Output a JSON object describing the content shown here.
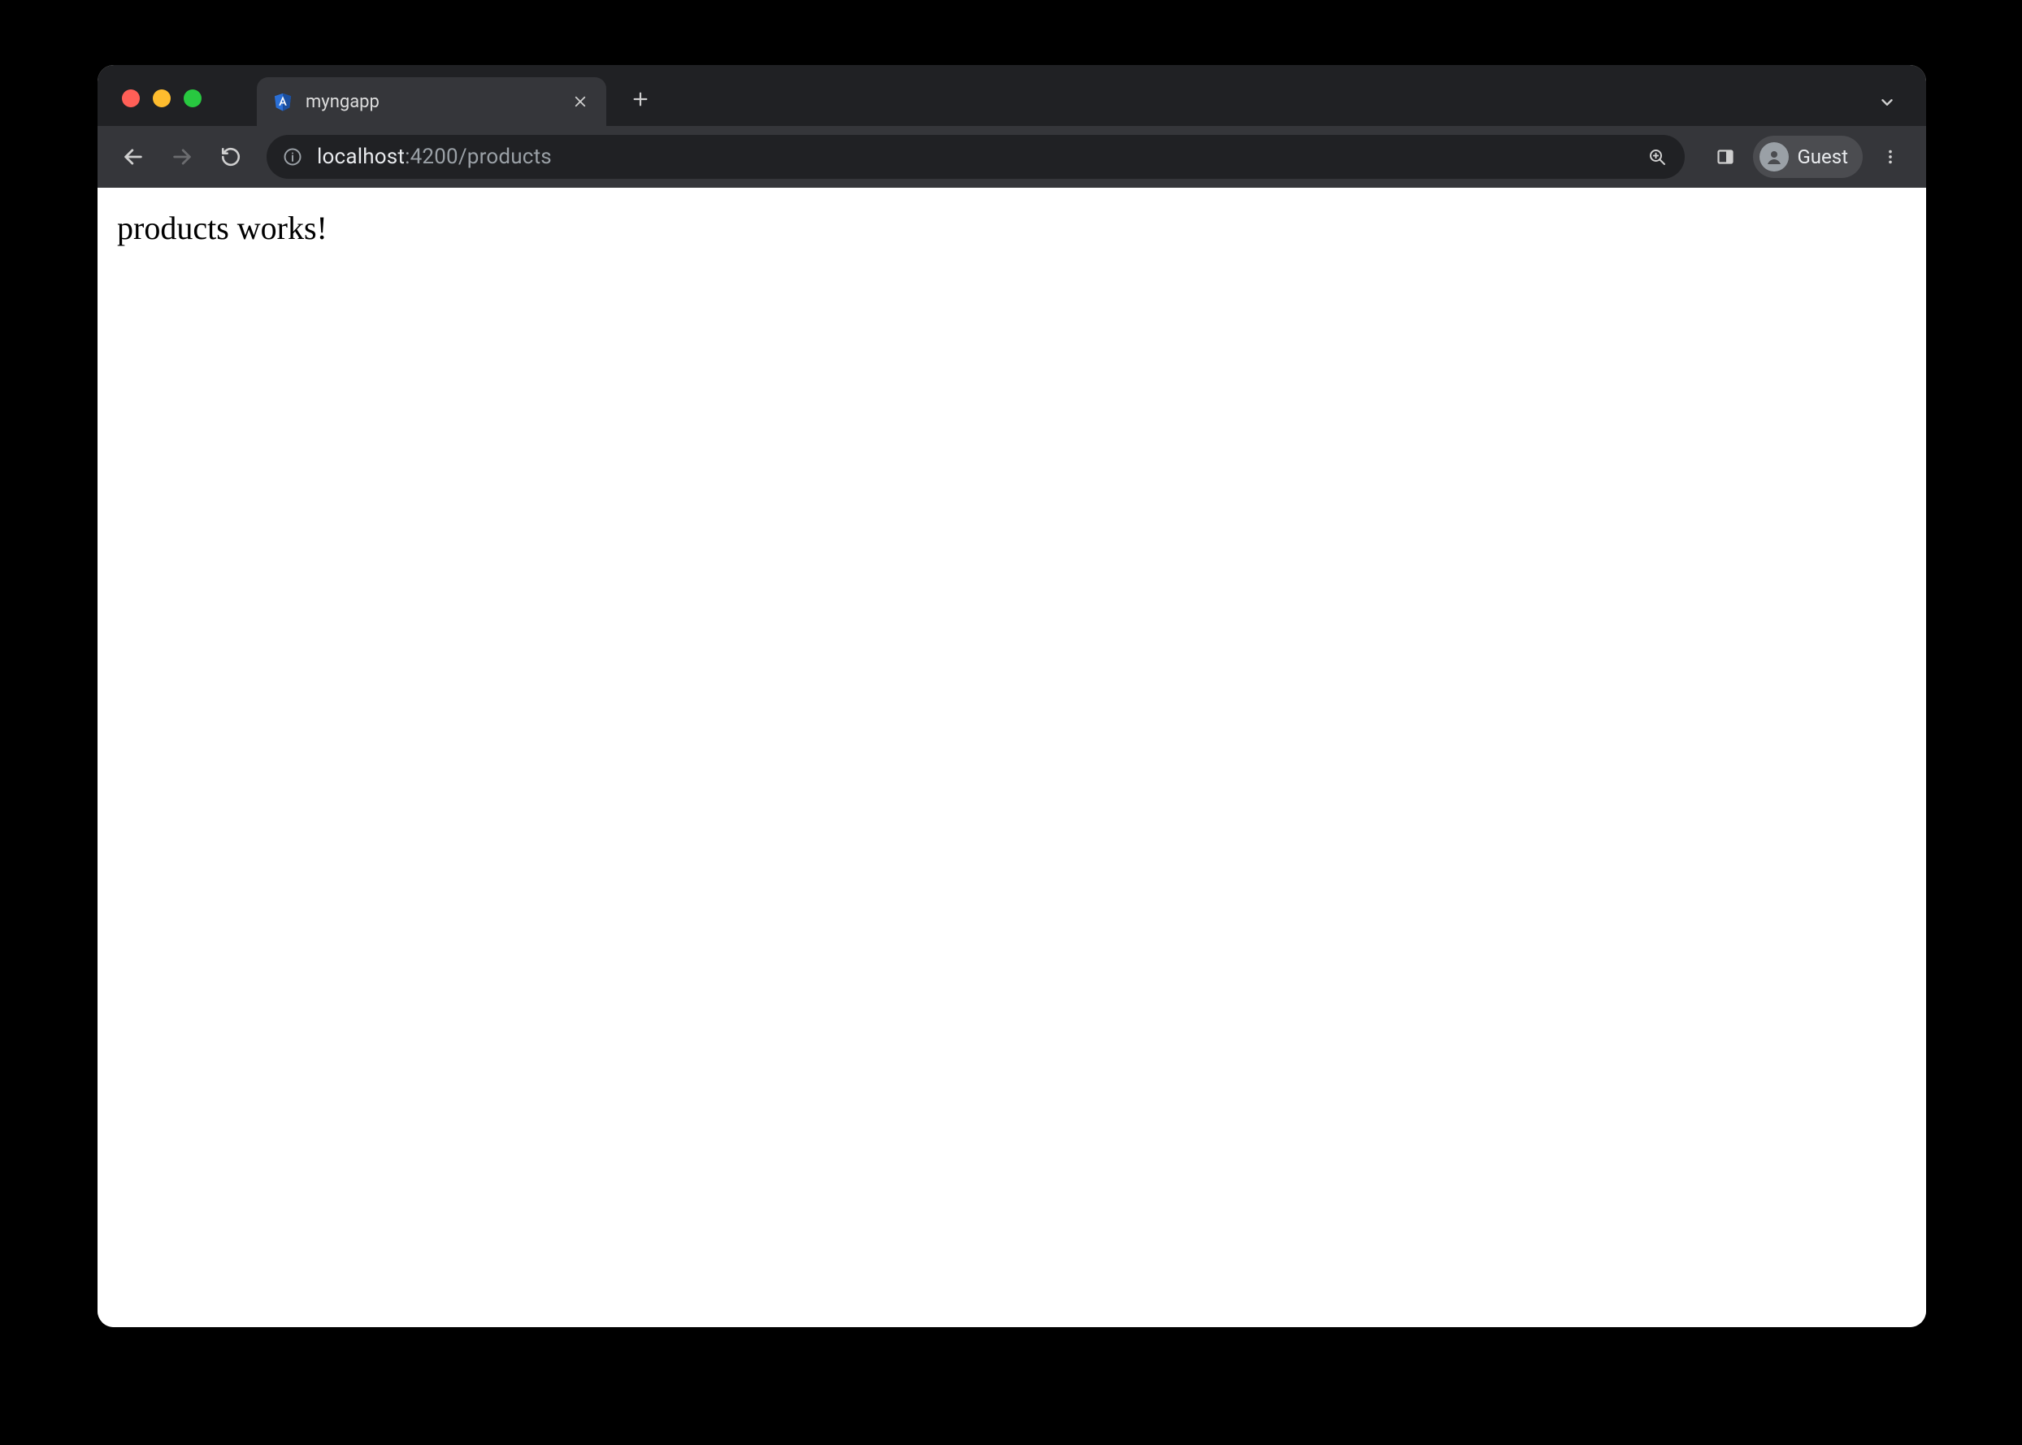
{
  "tab": {
    "title": "myngapp"
  },
  "addressbar": {
    "host": "localhost",
    "port_path": ":4200/products"
  },
  "profile": {
    "label": "Guest"
  },
  "page": {
    "text": "products works!"
  }
}
